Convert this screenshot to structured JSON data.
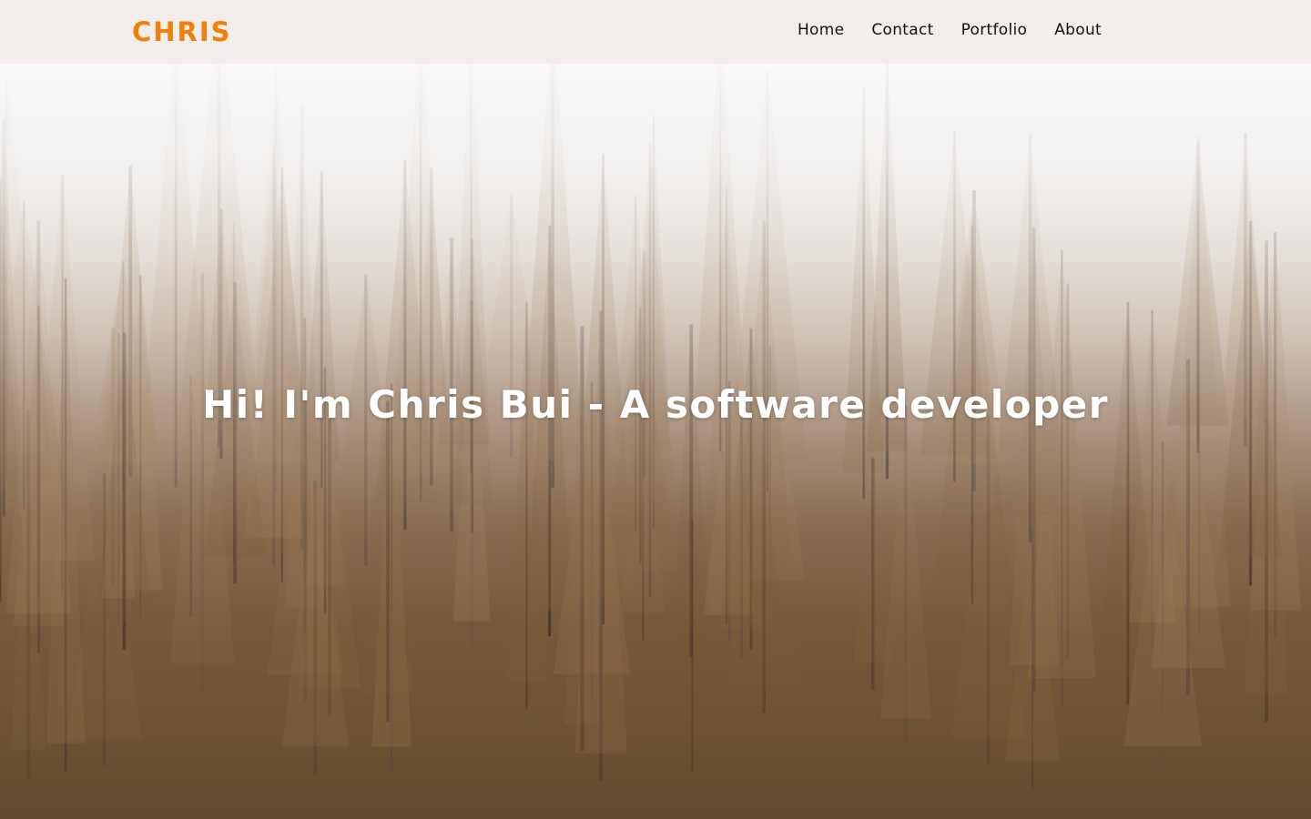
{
  "brand": {
    "name": "CHRIS",
    "color": "#f08007"
  },
  "nav": {
    "items": [
      {
        "label": "Home"
      },
      {
        "label": "Contact"
      },
      {
        "label": "Portfolio"
      },
      {
        "label": "About"
      }
    ]
  },
  "hero": {
    "title": "Hi! I'm Chris Bui - A software developer",
    "background": "foggy-autumn-forest-image"
  }
}
